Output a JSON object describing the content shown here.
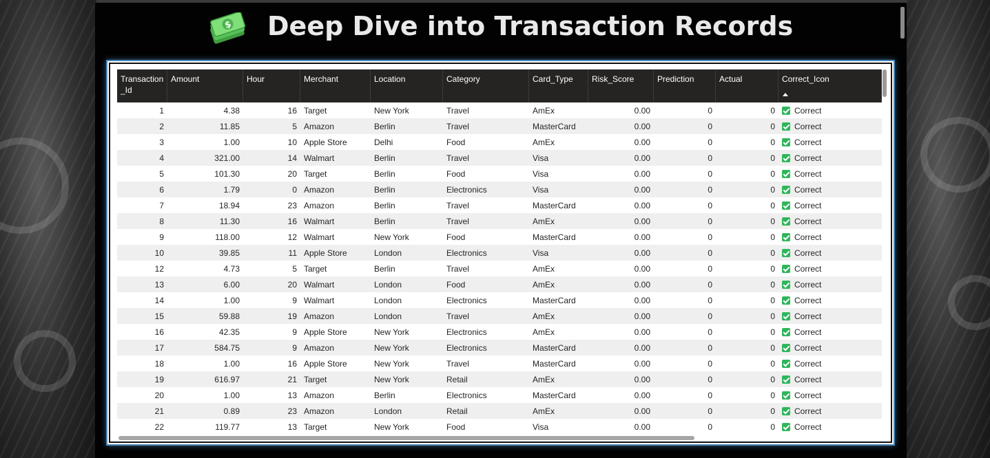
{
  "title": "Deep Dive into Transaction Records",
  "icon": "money-banknotes-icon",
  "colors": {
    "header_bg": "#252423",
    "frame_border": "#4a86b6",
    "check_green": "#2fb65a",
    "title_text": "#e9e9e9"
  },
  "table": {
    "columns": [
      {
        "label": "Transaction_Id",
        "align": "right"
      },
      {
        "label": "Amount",
        "align": "right"
      },
      {
        "label": "Hour",
        "align": "right"
      },
      {
        "label": "Merchant",
        "align": "left"
      },
      {
        "label": "Location",
        "align": "left"
      },
      {
        "label": "Category",
        "align": "left"
      },
      {
        "label": "Card_Type",
        "align": "left"
      },
      {
        "label": "Risk_Score",
        "align": "right"
      },
      {
        "label": "Prediction",
        "align": "right"
      },
      {
        "label": "Actual",
        "align": "right"
      },
      {
        "label": "Correct_Icon",
        "align": "left"
      }
    ],
    "sorted_column": "Correct_Icon",
    "sort_direction": "ascending",
    "rows": [
      [
        "1",
        "4.38",
        "16",
        "Target",
        "New York",
        "Travel",
        "AmEx",
        "0.00",
        "0",
        "0",
        "Correct"
      ],
      [
        "2",
        "11.85",
        "5",
        "Amazon",
        "Berlin",
        "Travel",
        "MasterCard",
        "0.00",
        "0",
        "0",
        "Correct"
      ],
      [
        "3",
        "1.00",
        "10",
        "Apple Store",
        "Delhi",
        "Food",
        "AmEx",
        "0.00",
        "0",
        "0",
        "Correct"
      ],
      [
        "4",
        "321.00",
        "14",
        "Walmart",
        "Berlin",
        "Travel",
        "Visa",
        "0.00",
        "0",
        "0",
        "Correct"
      ],
      [
        "5",
        "101.30",
        "20",
        "Target",
        "Berlin",
        "Food",
        "Visa",
        "0.00",
        "0",
        "0",
        "Correct"
      ],
      [
        "6",
        "1.79",
        "0",
        "Amazon",
        "Berlin",
        "Electronics",
        "Visa",
        "0.00",
        "0",
        "0",
        "Correct"
      ],
      [
        "7",
        "18.94",
        "23",
        "Amazon",
        "Berlin",
        "Travel",
        "MasterCard",
        "0.00",
        "0",
        "0",
        "Correct"
      ],
      [
        "8",
        "11.30",
        "16",
        "Walmart",
        "Berlin",
        "Travel",
        "AmEx",
        "0.00",
        "0",
        "0",
        "Correct"
      ],
      [
        "9",
        "118.00",
        "12",
        "Walmart",
        "New York",
        "Food",
        "MasterCard",
        "0.00",
        "0",
        "0",
        "Correct"
      ],
      [
        "10",
        "39.85",
        "11",
        "Apple Store",
        "London",
        "Electronics",
        "Visa",
        "0.00",
        "0",
        "0",
        "Correct"
      ],
      [
        "12",
        "4.73",
        "5",
        "Target",
        "Berlin",
        "Travel",
        "AmEx",
        "0.00",
        "0",
        "0",
        "Correct"
      ],
      [
        "13",
        "6.00",
        "20",
        "Walmart",
        "London",
        "Food",
        "AmEx",
        "0.00",
        "0",
        "0",
        "Correct"
      ],
      [
        "14",
        "1.00",
        "9",
        "Walmart",
        "London",
        "Electronics",
        "MasterCard",
        "0.00",
        "0",
        "0",
        "Correct"
      ],
      [
        "15",
        "59.88",
        "19",
        "Amazon",
        "London",
        "Travel",
        "AmEx",
        "0.00",
        "0",
        "0",
        "Correct"
      ],
      [
        "16",
        "42.35",
        "9",
        "Apple Store",
        "New York",
        "Electronics",
        "AmEx",
        "0.00",
        "0",
        "0",
        "Correct"
      ],
      [
        "17",
        "584.75",
        "9",
        "Amazon",
        "New York",
        "Electronics",
        "MasterCard",
        "0.00",
        "0",
        "0",
        "Correct"
      ],
      [
        "18",
        "1.00",
        "16",
        "Apple Store",
        "New York",
        "Travel",
        "MasterCard",
        "0.00",
        "0",
        "0",
        "Correct"
      ],
      [
        "19",
        "616.97",
        "21",
        "Target",
        "New York",
        "Retail",
        "AmEx",
        "0.00",
        "0",
        "0",
        "Correct"
      ],
      [
        "20",
        "1.00",
        "13",
        "Amazon",
        "Berlin",
        "Electronics",
        "MasterCard",
        "0.00",
        "0",
        "0",
        "Correct"
      ],
      [
        "21",
        "0.89",
        "23",
        "Amazon",
        "London",
        "Retail",
        "AmEx",
        "0.00",
        "0",
        "0",
        "Correct"
      ],
      [
        "22",
        "119.77",
        "13",
        "Target",
        "New York",
        "Food",
        "Visa",
        "0.00",
        "0",
        "0",
        "Correct"
      ]
    ]
  }
}
